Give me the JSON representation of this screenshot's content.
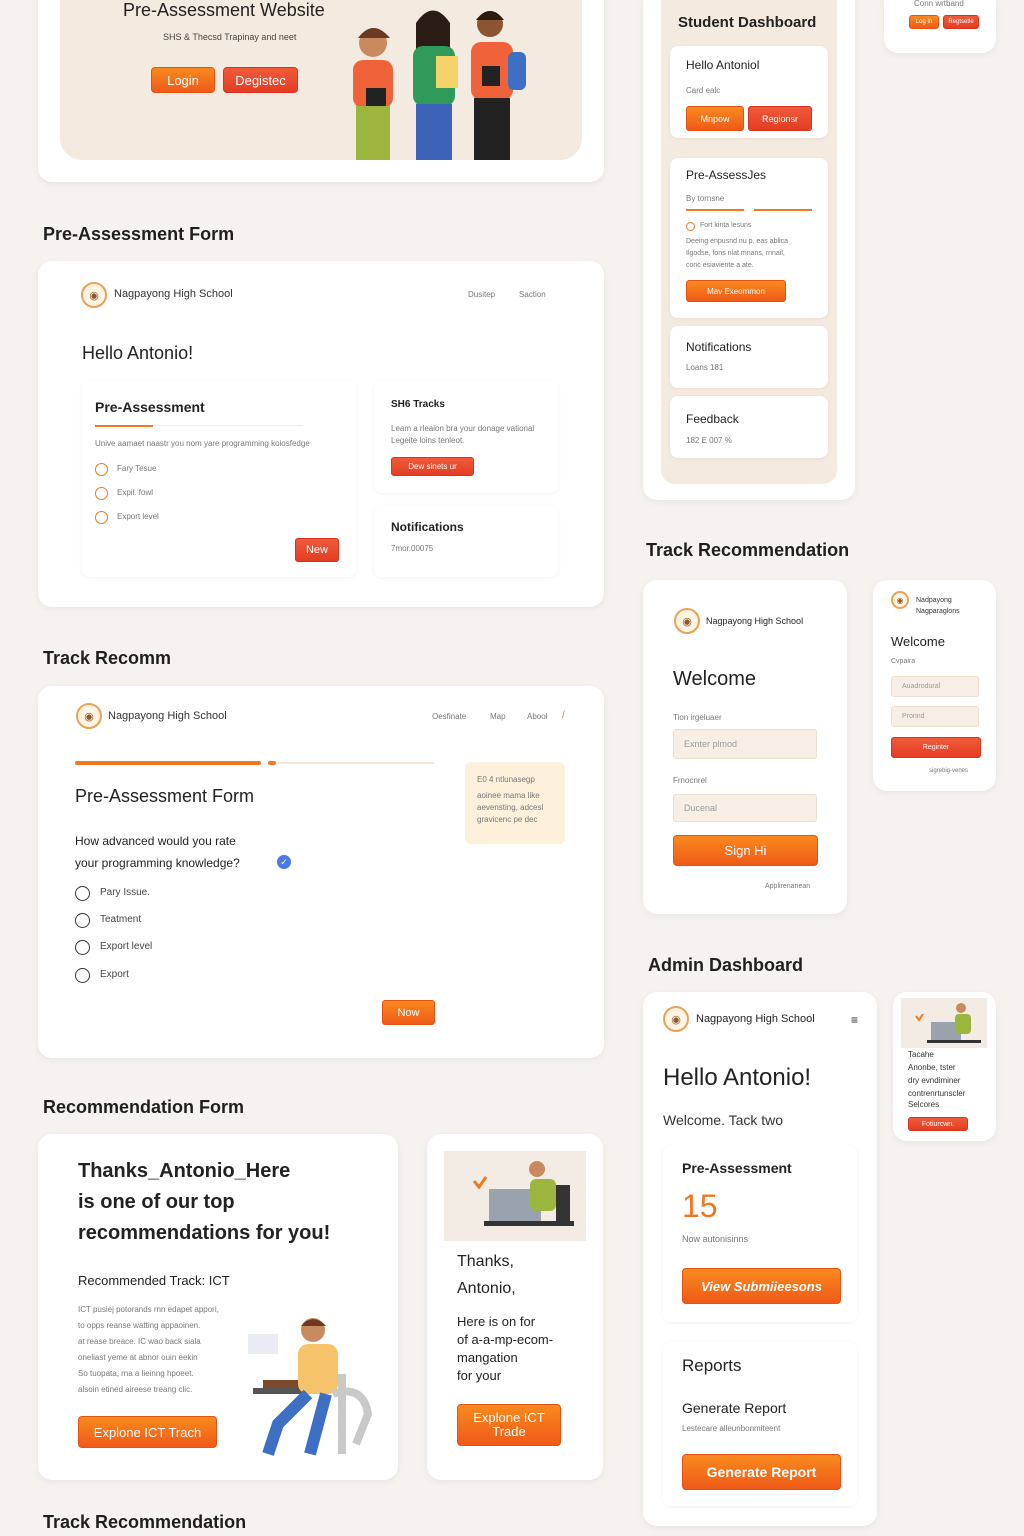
{
  "hero": {
    "title": "Pre-Assessment Website",
    "subtitle": "SHS & Thecsd Trapinay and neet",
    "login_label": "Login",
    "register_label": "Degistec"
  },
  "sections": {
    "pre_assessment_form": "Pre-Assessment Form",
    "track_recomm": "Track Recomm",
    "recommendation_form": "Recommendation Form",
    "track_recommendation_bottom": "Track Recommendation",
    "track_recommendation_right": "Track Recommendation",
    "admin_dashboard": "Admin Dashboard"
  },
  "form1": {
    "school": "Nagpayong High School",
    "nav": [
      "Dusitep",
      "Saction"
    ],
    "greeting": "Hello Antonio!",
    "pa_title": "Pre-Assessment",
    "pa_question": "Unive aamaet naastr you nom yare programming koiosfedge",
    "options": [
      "Fary Tesue",
      "Expil. fowl",
      "Export level"
    ],
    "next_label": "New",
    "tracks_title": "SH6 Tracks",
    "tracks_desc": "Leam a rleaion bra your donage vational Legeite loins tenleot.",
    "tracks_btn": "Dew sinets ur",
    "notif_title": "Notifications",
    "notif_text": "7mor.00075"
  },
  "form2": {
    "school": "Nagpayong High School",
    "nav": [
      "Oesfinate",
      "Map",
      "Abool"
    ],
    "title": "Pre-Assessment Form",
    "question_line1": "How advanced would you rate",
    "question_line2": "your programming knowledge?",
    "options": [
      "Pary Issue.",
      "Teatment",
      "Export level",
      "Export"
    ],
    "next_label": "Now",
    "note_title": "E0 4 ntlunasegp",
    "note_text": "aoinee mama like aevensting, adcesl gravicenc pe dec"
  },
  "recommendation": {
    "heading_line1": "Thanks_Antonio_Here",
    "heading_line2": "is one of our top",
    "heading_line3": "recommendations for you!",
    "track": "Recommended Track: ICT",
    "desc_lines": [
      "ICT pusiej potorands rnn edapet appori,",
      "to opps reanse watting appaoinen.",
      "at rease breace. IC wao back siala",
      "oneliast yeme at abnor ouin eekin",
      "So tuopata, rna a lieinng hpoeet.",
      "alsoin etined aireese treang clic."
    ],
    "explore_label": "Explone ICT Trach"
  },
  "recommendation_small": {
    "line1": "Thanks,",
    "line2": "Antonio,",
    "line3": "Here is on for",
    "line4": "of a-a-mp-ecom-",
    "line5": "mangation",
    "line6": "for your",
    "btn_line1": "Explone ICT",
    "btn_line2": "Trade"
  },
  "top_right_mini": {
    "label": "Conn wrtband",
    "login": "Log in",
    "register": "Regtsetle"
  },
  "student_dashboard": {
    "title": "Student Dashboard",
    "hello": "Hello Antoniol",
    "card_label": "Card ealc",
    "btn1": "Mnpow",
    "btn2": "Regionsr",
    "pa_title": "Pre-AssessJes",
    "pa_sub": "By tornsne",
    "pa_option": "Fort kinta lesuns",
    "pa_desc1": "Deeing enpusnd nu p, eas ablicа",
    "pa_desc2": "Ilgodse, fons nlat mnans, rnnail,",
    "pa_desc3": "conc esiaviente a ate.",
    "pa_btn": "Mav Exeommon",
    "notif_title": "Notifications",
    "notif_text": "Loans 181",
    "feedback_title": "Feedback",
    "feedback_text": "182 E 007 %"
  },
  "signin": {
    "school": "Nagpayong High School",
    "welcome": "Welcome",
    "field1_label": "Tion irgeluaer",
    "field1_placeholder": "Exnter plmod",
    "field2_label": "Frnocnrel",
    "field2_placeholder": "Ducenal",
    "signin_label": "Sign Hi",
    "link": "Applirenanean"
  },
  "signin_mini": {
    "school_line1": "Nadpayong",
    "school_line2": "Nagparaglons",
    "welcome": "Welcome",
    "label": "Cvpaira",
    "field1": "Auadrodural",
    "field2": "Pronnd",
    "register": "Reginter",
    "link": "sigrebig-venes"
  },
  "admin": {
    "school": "Nagpayong High School",
    "hello": "Hello Antonio!",
    "welcome": "Welcome. Tack two",
    "pa_title": "Pre-Assessment",
    "count": "15",
    "count_label": "Now autonisinns",
    "view_label": "View Submiieesons",
    "reports_title": "Reports",
    "generate_title": "Generate Report",
    "generate_desc": "Lestecare alleunbonmiteent",
    "generate_label": "Generate Report"
  },
  "admin_mini": {
    "line1": "Tacahe",
    "line2": "Anonbe, tster",
    "line3": "dry evndiminer",
    "line4": "contrenrtunscler",
    "line5": "Selcores",
    "btn": "Fotiurcwn."
  }
}
